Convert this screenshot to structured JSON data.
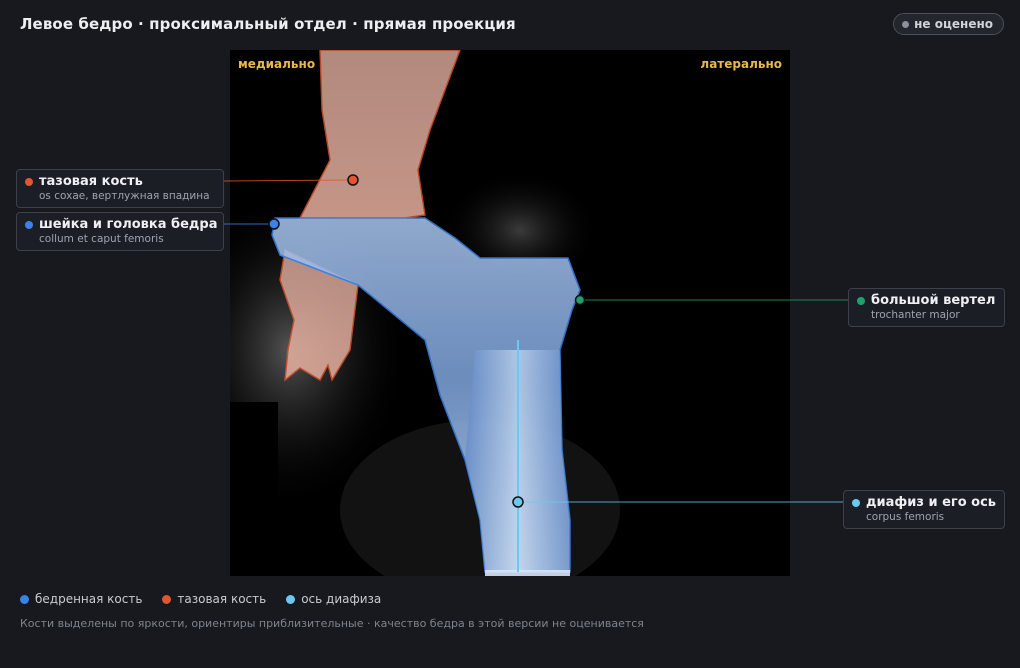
{
  "header": {
    "title": "Левое бедро · проксимальный отдел · прямая проекция",
    "status": "не оценено"
  },
  "viewer": {
    "orient_left": "медиально",
    "orient_right": "латерально"
  },
  "labels": {
    "pelvis": {
      "name": "тазовая кость",
      "latin": "os coxae, вертлужная впадина",
      "color": "#e0562e"
    },
    "neck": {
      "name": "шейка и головка бедра",
      "latin": "collum et caput femoris",
      "color": "#3b82e6"
    },
    "trochanter": {
      "name": "большой вертел",
      "latin": "trochanter major",
      "color": "#22a06b"
    },
    "shaft": {
      "name": "диафиз и его ось",
      "latin": "corpus femoris",
      "color": "#6cc8f0"
    }
  },
  "legend": [
    {
      "label": "бедренная кость",
      "color": "#3b82e6"
    },
    {
      "label": "тазовая кость",
      "color": "#e0562e"
    },
    {
      "label": "ось диафиза",
      "color": "#6cc8f0"
    }
  ],
  "footnote": "Кости выделены по яркости, ориентиры приблизительные · качество бедра в этой версии не оценивается"
}
